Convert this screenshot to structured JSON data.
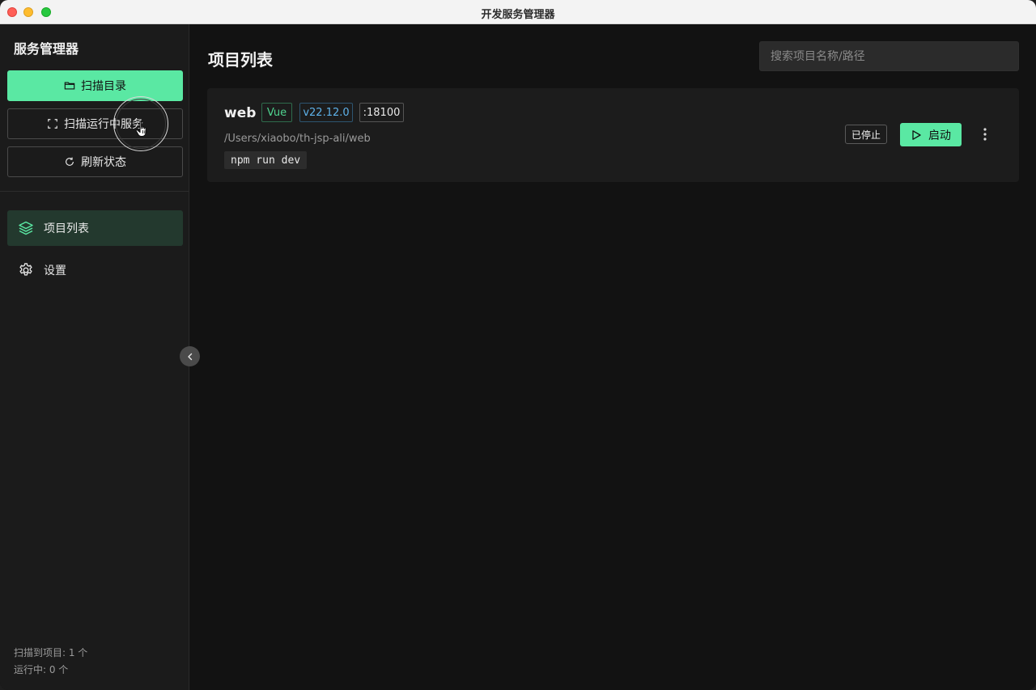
{
  "window": {
    "title": "开发服务管理器"
  },
  "sidebar": {
    "app_title": "服务管理器",
    "buttons": [
      {
        "label": "扫描目录",
        "icon": "folder-icon"
      },
      {
        "label": "扫描运行中服务",
        "icon": "scan-icon"
      },
      {
        "label": "刷新状态",
        "icon": "refresh-icon"
      }
    ],
    "nav": [
      {
        "label": "项目列表",
        "icon": "layers-icon",
        "active": true
      },
      {
        "label": "设置",
        "icon": "gear-icon",
        "active": false
      }
    ],
    "footer": {
      "scanned": "扫描到项目: 1 个",
      "running": "运行中: 0 个"
    }
  },
  "main": {
    "title": "项目列表",
    "search": {
      "placeholder": "搜索项目名称/路径",
      "value": ""
    },
    "projects": [
      {
        "name": "web",
        "framework": "Vue",
        "node_version": "v22.12.0",
        "port": ":18100",
        "path": "/Users/xiaobo/th-jsp-ali/web",
        "command": "npm run dev",
        "status": "已停止",
        "action_label": "启动"
      }
    ]
  },
  "colors": {
    "accent": "#5ae8a3",
    "sidebar_bg": "#1b1b1b",
    "main_bg": "#121212",
    "card_bg": "#1c1c1c",
    "vue_tag": "#4fd38f",
    "node_tag": "#5eb2ea"
  }
}
